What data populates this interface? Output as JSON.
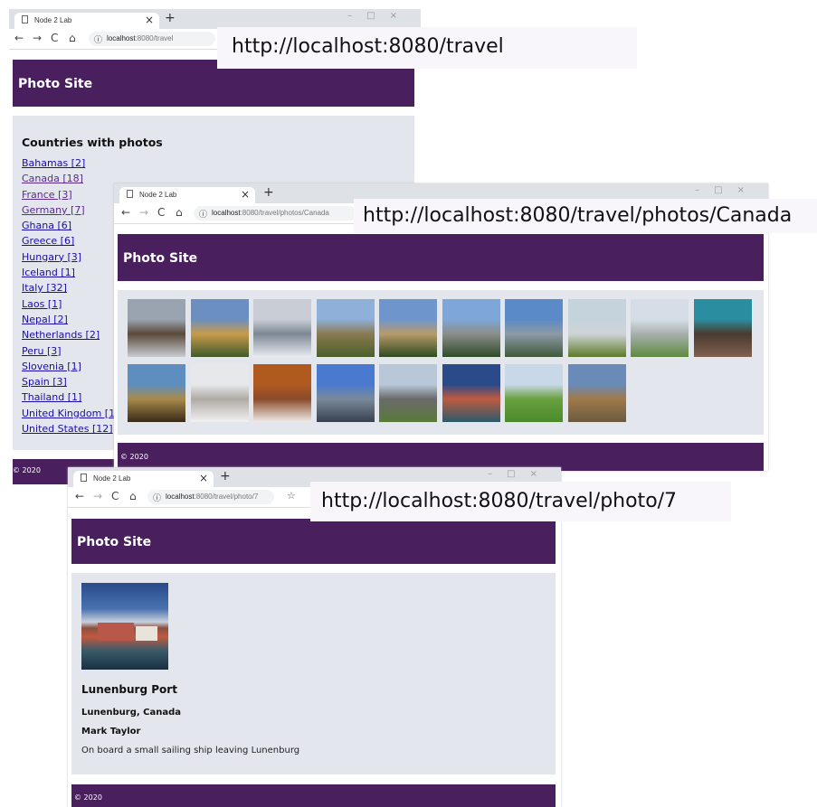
{
  "win1": {
    "tab_title": "Node 2 Lab",
    "url_host": "localhost",
    "url_path": ":8080/travel",
    "header": "Photo Site",
    "heading": "Countries with photos",
    "countries": [
      "Bahamas [2]",
      "Canada [18]",
      "France [3]",
      "Germany [7]",
      "Ghana [6]",
      "Greece [6]",
      "Hungary [3]",
      "Iceland [1]",
      "Italy [32]",
      "Laos [1]",
      "Nepal [2]",
      "Netherlands [2]",
      "Peru [3]",
      "Slovenia [1]",
      "Spain [3]",
      "Thailand [1]",
      "United Kingdom [1]",
      "United States [12]"
    ],
    "footer": "© 2020"
  },
  "win2": {
    "tab_title": "Node 2 Lab",
    "url_host": "localhost",
    "url_path": ":8080/travel/photos/Canada",
    "header": "Photo Site",
    "footer": "© 2020",
    "photos": [
      {
        "colors": [
          "#9aa3b0",
          "#5a4a3a",
          "#c8ccd2"
        ]
      },
      {
        "colors": [
          "#6a8fc0",
          "#c89b4a",
          "#3f5b2a"
        ]
      },
      {
        "colors": [
          "#c9ced6",
          "#7d8794",
          "#e8ecf0"
        ]
      },
      {
        "colors": [
          "#8fb0d8",
          "#8a7a52",
          "#4a5f2a"
        ]
      },
      {
        "colors": [
          "#6e96cc",
          "#b89a6a",
          "#2f4a20"
        ]
      },
      {
        "colors": [
          "#7ea6d8",
          "#8c8e8a",
          "#2e4a28"
        ]
      },
      {
        "colors": [
          "#5a8ac8",
          "#8e9aa6",
          "#3e5a3a"
        ]
      },
      {
        "colors": [
          "#c4d3dc",
          "#cfd4d6",
          "#5d7a2a"
        ]
      },
      {
        "colors": [
          "#d5dde6",
          "#a8b0ae",
          "#5d8a40"
        ]
      },
      {
        "colors": [
          "#2a8ea0",
          "#4a3a30",
          "#806050"
        ]
      },
      {
        "colors": [
          "#5e8ec0",
          "#a88a4a",
          "#3a2a18"
        ]
      },
      {
        "colors": [
          "#e6e8ec",
          "#b0aaa4",
          "#f2f2f2"
        ]
      },
      {
        "colors": [
          "#b05a20",
          "#8a4a2a",
          "#f0ece8"
        ]
      },
      {
        "colors": [
          "#4a7ad0",
          "#7a8a9a",
          "#3a4050"
        ]
      },
      {
        "colors": [
          "#b8c8d8",
          "#6a6a6a",
          "#5a7a3a"
        ]
      },
      {
        "colors": [
          "#2a4a8a",
          "#c05a40",
          "#2a5a6a"
        ]
      },
      {
        "colors": [
          "#c8d8e8",
          "#6aa040",
          "#4a8a2a"
        ]
      },
      {
        "colors": [
          "#6a8ab8",
          "#a07a4a",
          "#6a5a40"
        ]
      }
    ]
  },
  "win3": {
    "tab_title": "Node 2 Lab",
    "url_host": "localhost",
    "url_path": ":8080/travel/photo/7",
    "header": "Photo Site",
    "title": "Lunenburg Port",
    "location": "Lunenburg, Canada",
    "author": "Mark Taylor",
    "description": "On board a small sailing ship leaving Lunenburg",
    "footer": "© 2020"
  },
  "callouts": {
    "url1": "http://localhost:8080/travel",
    "url2": "http://localhost:8080/travel/photos/Canada",
    "url3": "http://localhost:8080/travel/photo/7"
  },
  "colors": {
    "brand": "#4a1f5e",
    "panel": "#e3e6ec",
    "link": "#1a0dab",
    "visited": "#5a2a8a"
  }
}
